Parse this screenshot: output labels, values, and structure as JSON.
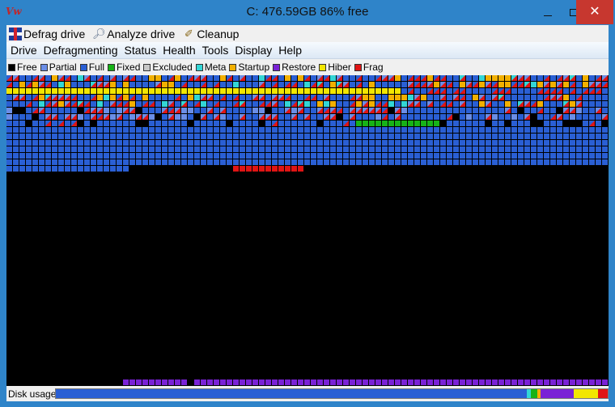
{
  "window": {
    "title": "C:  476.59GB 86% free",
    "app_icon_glyph": "Vw",
    "min_glyph": "",
    "close_glyph": "✕"
  },
  "toolbar": {
    "defrag_label": "Defrag drive",
    "analyze_label": "Analyze drive",
    "cleanup_label": "Cleanup",
    "icons": {
      "defrag": "flag-icon",
      "analyze": "magnifier-icon",
      "cleanup": "broom-icon"
    }
  },
  "menu": {
    "items": [
      "Drive",
      "Defragmenting",
      "Status",
      "Health",
      "Tools",
      "Display",
      "Help"
    ]
  },
  "legend": {
    "items": [
      {
        "label": "Free",
        "color": "#000000"
      },
      {
        "label": "Partial",
        "color": "#6b8ee6"
      },
      {
        "label": "Full",
        "color": "#2a5fd4"
      },
      {
        "label": "Fixed",
        "color": "#17b317"
      },
      {
        "label": "Excluded",
        "color": "#c8c8c8"
      },
      {
        "label": "Meta",
        "color": "#33d6d6"
      },
      {
        "label": "Startup",
        "color": "#f2b000"
      },
      {
        "label": "Restore",
        "color": "#7a22d6"
      },
      {
        "label": "Hiber",
        "color": "#f2e600"
      },
      {
        "label": "Frag",
        "color": "#e01414"
      }
    ]
  },
  "usage": {
    "label": "Disk usage",
    "segments": [
      {
        "state": "Full",
        "share": 0.854,
        "color": "#2a5fd4"
      },
      {
        "state": "Meta",
        "share": 0.006,
        "color": "#33d6d6"
      },
      {
        "state": "Fixed",
        "share": 0.012,
        "color": "#17b317"
      },
      {
        "state": "Startup",
        "share": 0.006,
        "color": "#f2b000"
      },
      {
        "state": "Restore",
        "share": 0.06,
        "color": "#7a22d6"
      },
      {
        "state": "Hiber",
        "share": 0.045,
        "color": "#f2e600"
      },
      {
        "state": "Frag",
        "share": 0.017,
        "color": "#e01414"
      }
    ]
  },
  "cluster_map": {
    "columns": 93,
    "rows": 48,
    "background_state": "Free",
    "row_states": [
      "mixed-top",
      "mixed-top",
      "hiber-band",
      "mixed-top",
      "mixed-top",
      "mixed-gap",
      "mixed-gap",
      "gap-row",
      "full",
      "full",
      "full",
      "full",
      "full",
      "full",
      "full-end"
    ],
    "restore_band_state": "Restore"
  }
}
